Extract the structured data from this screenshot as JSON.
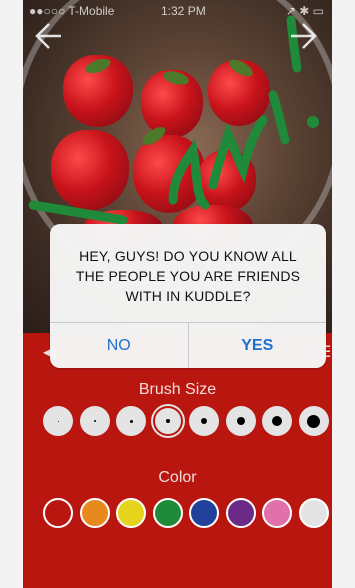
{
  "status_bar": {
    "carrier": "●●○○○ T-Mobile",
    "time": "1:32 PM",
    "indicators": "↗ ✱ ▭"
  },
  "nav": {
    "back_icon": "arrow-left-icon",
    "forward_icon": "arrow-right-icon"
  },
  "dialog": {
    "message_line1": "HEY, GUYS! DO YOU KNOW ALL",
    "message_line2": "THE PEOPLE YOU ARE FRIENDS",
    "message_line3": "WITH IN KUDDLE?",
    "no_label": "NO",
    "yes_label": "YES"
  },
  "toolbar": {
    "left_glyph": "◀",
    "right_glyph": "☰"
  },
  "brush": {
    "label": "Brush Size",
    "sizes": [
      1,
      2,
      3,
      4,
      6,
      8,
      10,
      13
    ],
    "selected_index": 3
  },
  "color": {
    "label": "Color",
    "swatches": [
      "#b8160f",
      "#e8891e",
      "#e6d31c",
      "#1f8a3a",
      "#22419a",
      "#6a2a86",
      "#e270aa",
      "#e4e4e4"
    ]
  },
  "colors": {
    "background": "#b8160f",
    "accent": "#1e6fd0"
  }
}
